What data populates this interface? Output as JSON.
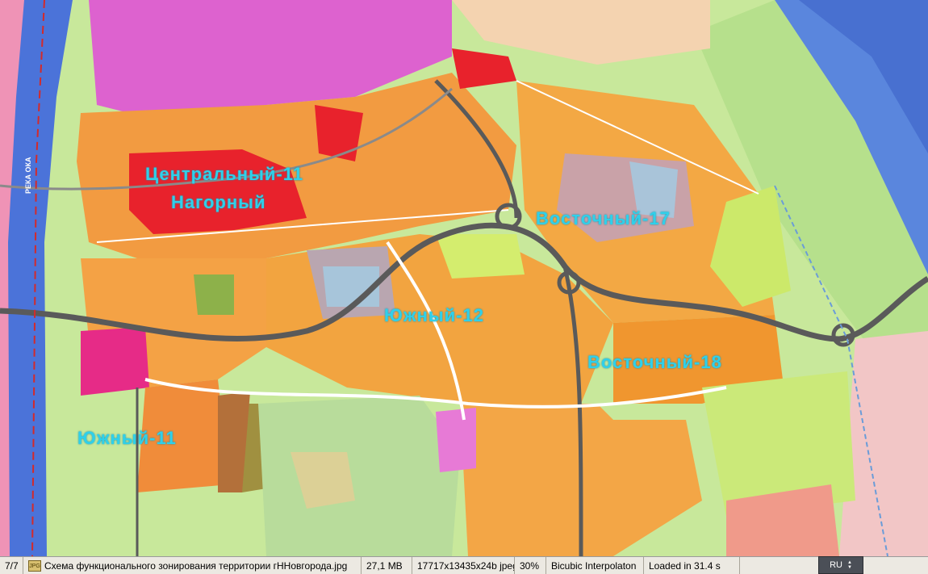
{
  "map": {
    "district_labels": [
      "Центральный-11",
      "Нагорный",
      "Восточный-17",
      "Южный-12",
      "Восточный-18",
      "Южный-11"
    ],
    "river_label": "РЕКА ОКА",
    "colors": {
      "residential": "#f19a3e",
      "public": "#e8242c",
      "business": "#e96bd6",
      "industrial": "#b7a2a6",
      "green": "#c7e98b",
      "park": "#5db769",
      "water": "#4b73d9",
      "road": "#5a5a5a"
    }
  },
  "statusbar": {
    "page": "7/7",
    "file_icon": "image-file-icon",
    "filename": "Схема функционального зонирования территории гННовгорода.jpg",
    "filesize": "27,1 MB",
    "dimensions": "17717x13435x24b jpeg",
    "zoom": "30%",
    "interpolation": "Bicubic Interpolaton",
    "load_time": "Loaded in 31.4 s"
  },
  "language": {
    "code": "RU"
  }
}
